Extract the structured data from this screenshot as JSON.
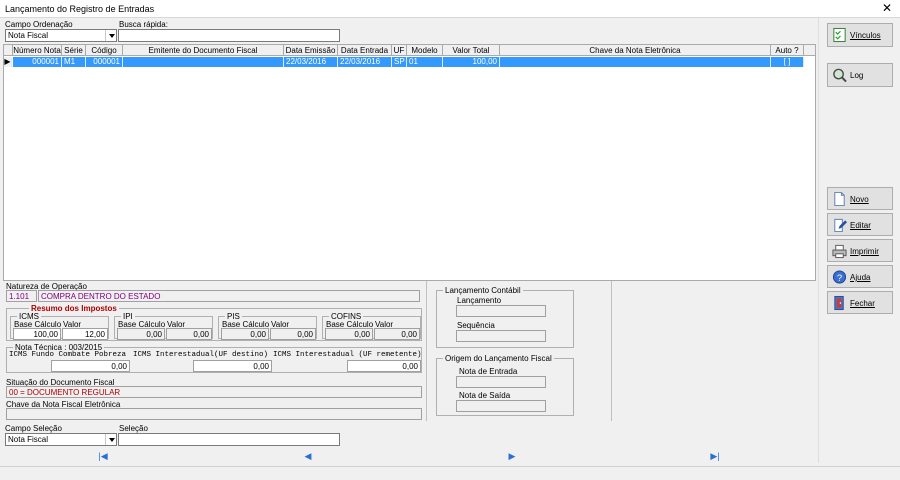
{
  "window": {
    "title": "Lançamento do Registro de Entradas",
    "close": "✕"
  },
  "top": {
    "ordenacao_label": "Campo Ordenação",
    "ordenacao_value": "Nota Fiscal",
    "busca_label": "Busca rápida:",
    "busca_value": ""
  },
  "grid": {
    "columns": [
      "Número Nota",
      "Série",
      "Código",
      "Emitente do Documento Fiscal",
      "Data Emissão",
      "Data Entrada",
      "UF",
      "Modelo",
      "Valor Total",
      "Chave da Nota Eletrônica",
      "Auto ?"
    ],
    "rows": [
      {
        "indicator": "▶",
        "numero": "000001",
        "serie": "M1",
        "codigo": "000001",
        "emitente": "",
        "emissao": "22/03/2016",
        "entrada": "22/03/2016",
        "uf": "SP",
        "modelo": "01",
        "valor": "100,00",
        "chave": "",
        "auto": "[ ]"
      }
    ]
  },
  "detail": {
    "natureza_label": "Natureza de Operação",
    "natureza_code": "1.101",
    "natureza_desc": "COMPRA DENTRO DO ESTADO",
    "resumo_title": "Resumo dos Impostos",
    "icms": {
      "title": "ICMS",
      "base_label": "Base Cálculo",
      "valor_label": "Valor",
      "base": "100,00",
      "valor": "12,00"
    },
    "ipi": {
      "title": "IPI",
      "base_label": "Base Cálculo",
      "valor_label": "Valor",
      "base": "0,00",
      "valor": "0,00"
    },
    "pis": {
      "title": "PIS",
      "base_label": "Base Cálculo",
      "valor_label": "Valor",
      "base": "0,00",
      "valor": "0,00"
    },
    "cofins": {
      "title": "COFINS",
      "base_label": "Base Cálculo",
      "valor_label": "Valor",
      "base": "0,00",
      "valor": "0,00"
    },
    "nota_tecnica_title": "Nota Técnica : 003/2015",
    "nt_label_1": "ICMS Fundo Combate Pobreza",
    "nt_label_2": "ICMS Interestadual(UF destino)",
    "nt_label_3": "ICMS Interestadual (UF remetente)",
    "nt_val_1": "0,00",
    "nt_val_2": "0,00",
    "nt_val_3": "0,00",
    "situacao_label": "Situação do Documento Fiscal",
    "situacao_value": "00 = DOCUMENTO REGULAR",
    "chave_label": "Chave da Nota Fiscal Eletrônica",
    "chave_value": ""
  },
  "contabil": {
    "title": "Lançamento Contábil",
    "lancamento_label": "Lançamento",
    "sequencia_label": "Sequência",
    "origem_title": "Origem do Lançamento Fiscal",
    "nota_entrada_label": "Nota de Entrada",
    "nota_saida_label": "Nota de Saída"
  },
  "bottom": {
    "selecao_campo_label": "Campo Seleção",
    "selecao_campo_value": "Nota Fiscal",
    "selecao_label": "Seleção",
    "selecao_value": ""
  },
  "sidebar": {
    "vinculos": "Vínculos",
    "log": "Log",
    "novo": "Novo",
    "editar": "Editar",
    "imprimir": "Imprimir",
    "ajuda": "Ajuda",
    "fechar": "Fechar"
  },
  "nav": {
    "first": "|◀",
    "prev": "◀",
    "next": "▶",
    "last": "▶|"
  }
}
